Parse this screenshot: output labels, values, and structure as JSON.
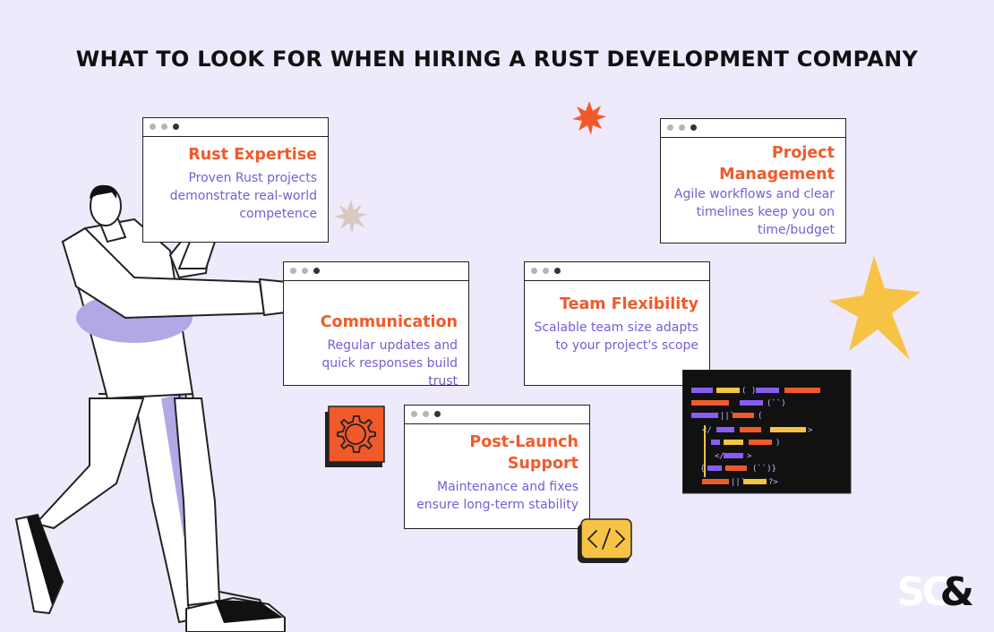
{
  "title": "WHAT TO LOOK FOR WHEN HIRING A RUST DEVELOPMENT COMPANY",
  "cards": [
    {
      "heading": "Rust Expertise",
      "text": "Proven Rust projects demonstrate real-world competence"
    },
    {
      "heading": "Communication",
      "text": "Regular updates and quick responses build trust"
    },
    {
      "heading": "Post-Launch Support",
      "text": "Maintenance and fixes ensure long-term stability"
    },
    {
      "heading": "Team Flexibility",
      "text": "Scalable team size adapts to your project's scope"
    },
    {
      "heading": "Project Management",
      "text": "Agile workflows and clear timelines keep you on time/budget"
    }
  ],
  "logo": {
    "letters": "SC",
    "amp": "&"
  },
  "colors": {
    "background": "#efe9fc",
    "heading": "#f05a2b",
    "body_text": "#7a5bd6",
    "accent_yellow": "#f7c344",
    "accent_purple": "#b3a7e6"
  },
  "icons": [
    "gear-icon",
    "code-brackets-icon",
    "starburst-icon",
    "code-window-icon",
    "person-illustration"
  ]
}
